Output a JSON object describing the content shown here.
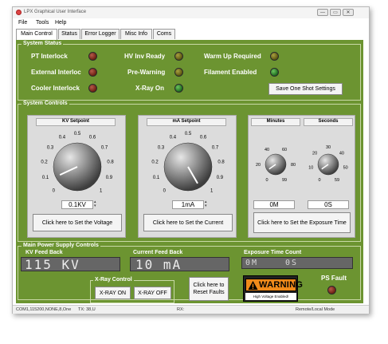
{
  "window": {
    "title": "LPX Graphical User Interface",
    "min_glyph": "—",
    "max_glyph": "▭",
    "close_glyph": "✕"
  },
  "menu": [
    "File",
    "Tools",
    "Help"
  ],
  "tabs": [
    "Main Control",
    "Status",
    "Error Logger",
    "Misc Info",
    "Coms"
  ],
  "system_status": {
    "title": "System Status",
    "pt_interlock": "PT Interlock",
    "external_interlock": "External Interloc",
    "cooler_interlock": "Cooler Interlock",
    "hv_inv_ready": "HV Inv Ready",
    "pre_warning": "Pre-Warning",
    "xray_on": "X-Ray On",
    "warm_up_required": "Warm Up Required",
    "filament_enabled": "Filament Enabled",
    "save_button": "Save One Shot Settings"
  },
  "system_controls": {
    "title": "System Controls",
    "kv": {
      "title": "KV Setpoint",
      "value": "0.1KV",
      "button": "Click here to Set the Voltage",
      "ticks": [
        "0",
        "0.1",
        "0.2",
        "0.3",
        "0.4",
        "0.5",
        "0.6",
        "0.7",
        "0.8",
        "0.9",
        "1"
      ]
    },
    "ma": {
      "title": "mA Setpoint",
      "value": "1mA",
      "button": "Click here to Set the Current",
      "ticks": [
        "0",
        "0.1",
        "0.2",
        "0.3",
        "0.4",
        "0.5",
        "0.6",
        "0.7",
        "0.8",
        "0.9",
        "1"
      ]
    },
    "minutes": {
      "title": "Minutes",
      "value": "0M",
      "ticks": [
        "0",
        "20",
        "40",
        "60",
        "80",
        "99"
      ]
    },
    "seconds": {
      "title": "Seconds",
      "value": "0S",
      "ticks": [
        "0",
        "10",
        "20",
        "30",
        "40",
        "50",
        "59"
      ]
    },
    "exposure_button": "Click here to Set the Exposure Time",
    "spin_up": "▴",
    "spin_down": "▾"
  },
  "power_supply": {
    "title": "Main Power Supply Controls",
    "kv_feedback_label": "KV Feed Back",
    "kv_feedback_value": "115 KV",
    "current_feedback_label": "Current Feed Back",
    "current_feedback_value": "10 mA",
    "exposure_count_label": "Exposure Time Count",
    "exposure_count_min": "0M",
    "exposure_count_sec": "0S",
    "xray_control_title": "X-Ray Control",
    "xray_on_button": "X-RAY ON",
    "xray_off_button": "X-RAY OFF",
    "reset_faults_button": "Click here to Reset Faults",
    "warning_text": "WARNING",
    "warning_subtext": "High Voltage Enabled!",
    "ps_fault": "PS Fault"
  },
  "statusbar": {
    "port": "COM1,115200,NONE,8,One",
    "tx": "TX: 38,U",
    "rx": "RX:",
    "mode": "Remote/Local Mode"
  }
}
